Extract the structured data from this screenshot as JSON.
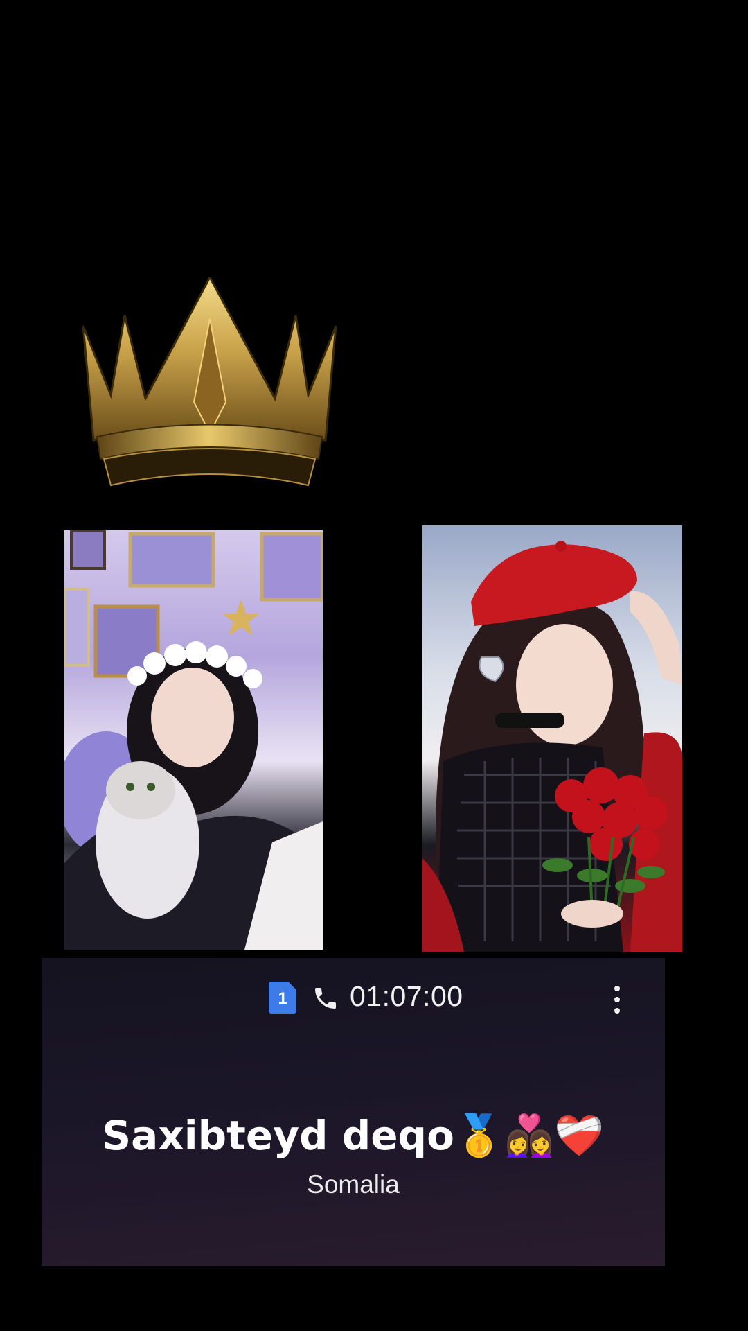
{
  "call": {
    "sim_number": "1",
    "timer": "01:07:00",
    "contact_name": "Saxibteyd deqo🥇👩‍❤️‍👩❤️‍🩹",
    "location": "Somalia"
  },
  "icons": {
    "crown": "crown-icon",
    "sim": "sim-badge-icon",
    "phone": "phone-icon",
    "menu": "more-vert-icon"
  },
  "colors": {
    "background": "#000000",
    "panel": "#1a1628",
    "sim_badge": "#3d7be8",
    "crown_gold": "#c9a24a"
  }
}
